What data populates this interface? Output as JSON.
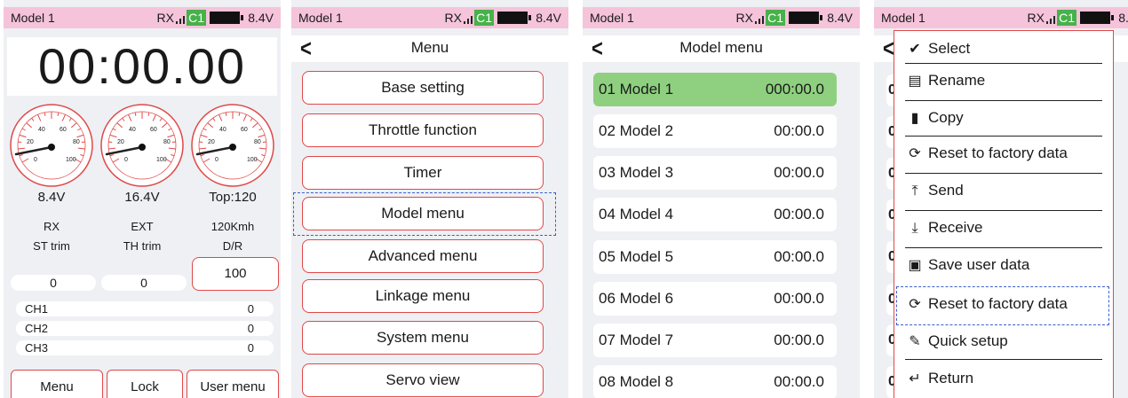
{
  "status": {
    "model": "Model 1",
    "rx": "RX",
    "c1": "C1",
    "voltage": "8.4V"
  },
  "home": {
    "timer": "00:00.00",
    "gauges": [
      {
        "value_label": "8.4V",
        "name": "RX",
        "trim_label": "ST trim",
        "trim_value": "0"
      },
      {
        "value_label": "16.4V",
        "name": "EXT",
        "trim_label": "TH trim",
        "trim_value": "0"
      },
      {
        "value_label": "Top:120",
        "name": "120Kmh",
        "trim_label": "D/R",
        "trim_value": "100"
      }
    ],
    "gauge_ticks": [
      "20",
      "40",
      "60",
      "80",
      "0",
      "100"
    ],
    "channels": [
      {
        "name": "CH1",
        "value": "0"
      },
      {
        "name": "CH2",
        "value": "0"
      },
      {
        "name": "CH3",
        "value": "0"
      }
    ],
    "buttons": {
      "menu": "Menu",
      "lock": "Lock",
      "user_menu": "User menu"
    }
  },
  "menu": {
    "title": "Menu",
    "items": [
      "Base setting",
      "Throttle function",
      "Timer",
      "Model menu",
      "Advanced menu",
      "Linkage menu",
      "System menu",
      "Servo view"
    ]
  },
  "model_menu": {
    "title": "Model menu",
    "models": [
      {
        "name": "01 Model 1",
        "time": "000:00.0"
      },
      {
        "name": "02 Model 2",
        "time": "00:00.0"
      },
      {
        "name": "03 Model 3",
        "time": "00:00.0"
      },
      {
        "name": "04 Model 4",
        "time": "00:00.0"
      },
      {
        "name": "05 Model 5",
        "time": "00:00.0"
      },
      {
        "name": "06 Model 6",
        "time": "00:00.0"
      },
      {
        "name": "07 Model 7",
        "time": "00:00.0"
      },
      {
        "name": "08 Model 8",
        "time": "00:00.0"
      }
    ]
  },
  "popup": {
    "items": [
      {
        "label": "Select",
        "icon": "check-icon"
      },
      {
        "label": "Rename",
        "icon": "rename-icon"
      },
      {
        "label": "Copy",
        "icon": "copy-icon"
      },
      {
        "label": "Reset to factory data",
        "icon": "refresh-icon"
      },
      {
        "label": "Send",
        "icon": "upload-icon"
      },
      {
        "label": "Receive",
        "icon": "download-icon"
      },
      {
        "label": "Save user data",
        "icon": "save-icon"
      },
      {
        "label": "Reset to factory data",
        "icon": "refresh-icon"
      },
      {
        "label": "Quick setup",
        "icon": "pencil-icon"
      },
      {
        "label": "Return",
        "icon": "return-icon"
      }
    ],
    "underlying_row_prefix": "0"
  },
  "colors": {
    "accent_red": "#e04848",
    "status_pink": "#f5c3da",
    "selected_green": "#8ed07f",
    "c1_green": "#46b24a",
    "focus_blue": "#3a5fc8"
  }
}
